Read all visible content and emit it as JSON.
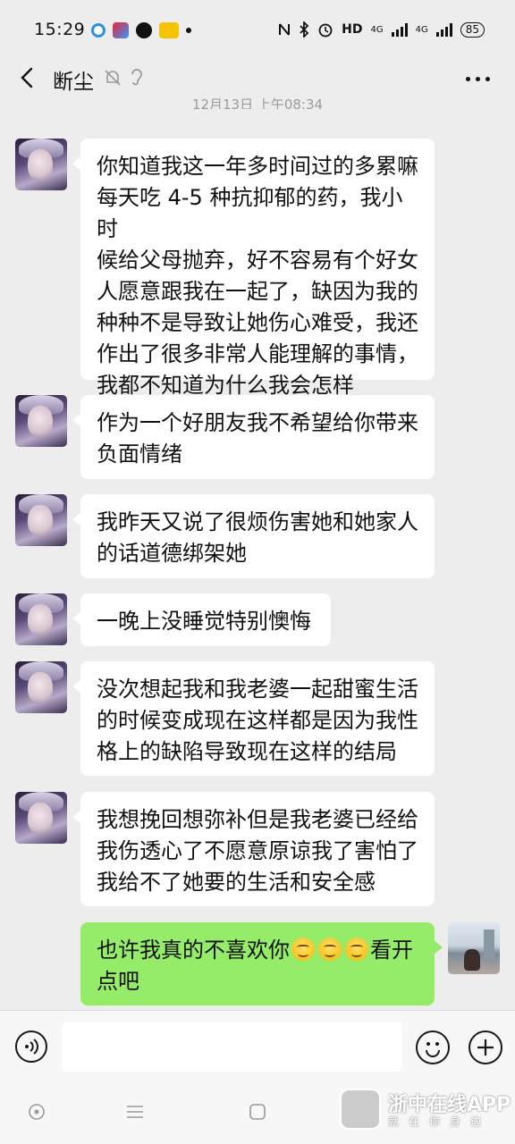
{
  "status_bar": {
    "time": "15:29",
    "network_label": "HD",
    "net1": "4G",
    "net2": "4G",
    "battery": "85"
  },
  "header": {
    "title": "断尘",
    "timestamp": "12月13日 上午08:34"
  },
  "messages": [
    {
      "side": "left",
      "text": "你知道我这一年多时间过的多累嘛\n每天吃 4-5 种抗抑郁的药，我小时\n候给父母抛弃，好不容易有个好女\n人愿意跟我在一起了，缺因为我的\n种种不是导致让她伤心难受，我还\n作出了很多非常人能理解的事情，\n我都不知道为什么我会怎样"
    },
    {
      "side": "left",
      "text": "作为一个好朋友我不希望给你带来\n负面情绪"
    },
    {
      "side": "left",
      "text": "我昨天又说了很烦伤害她和她家人\n的话道德绑架她"
    },
    {
      "side": "left",
      "text": "一晚上没睡觉特别懊悔"
    },
    {
      "side": "left",
      "text": "没次想起我和我老婆一起甜蜜生活\n的时候变成现在这样都是因为我性\n格上的缺陷导致现在这样的结局"
    },
    {
      "side": "left",
      "text": "我想挽回想弥补但是我老婆已经给\n我伤透心了不愿意原谅我了害怕了\n我给不了她要的生活和安全感"
    },
    {
      "side": "right",
      "text_before": "也许我真的不喜欢你",
      "text_after": "看开",
      "text_line2": "点吧",
      "emoji_count": 3
    }
  ],
  "watermark": {
    "title": "浙中在线APP",
    "subtitle": "就在你身边"
  },
  "colors": {
    "background": "#ededed",
    "bubble_left": "#ffffff",
    "bubble_right": "#95ec69"
  }
}
